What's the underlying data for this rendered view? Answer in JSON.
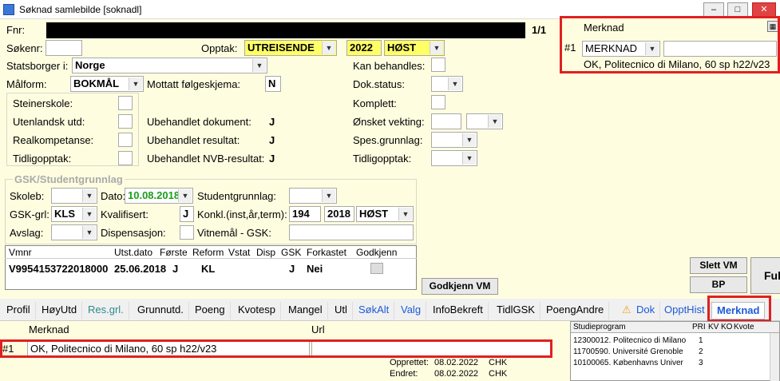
{
  "window": {
    "title": "Søknad samlebilde  [soknadl]",
    "minimize": "–",
    "restore": "□",
    "close": "✕"
  },
  "form": {
    "fnr_label": "Fnr:",
    "fnr_value": "",
    "page_indicator": "1/1",
    "sokenr_label": "Søkenr:",
    "sokenr_value": "",
    "opptak_label": "Opptak:",
    "opptak_value": "UTREISENDE",
    "year": "2022",
    "season": "HØST",
    "kan_behandles_label": "Kan behandles:",
    "statsborger_label": "Statsborger i:",
    "statsborger_value": "Norge",
    "malform_label": "Målform:",
    "malform_value": "BOKMÅL",
    "mottatt_label": "Mottatt følgeskjema:",
    "mottatt_value": "N",
    "dok_status_label": "Dok.status:",
    "steinerskole_label": "Steinerskole:",
    "utenlandsk_label": "Utenlandsk utd:",
    "realkompetanse_label": "Realkompetanse:",
    "tidligopptak_label": "Tidligopptak:",
    "komplett_label": "Komplett:",
    "ubehandlet_dok_label": "Ubehandlet dokument:",
    "ubehandlet_dok_value": "J",
    "onsket_label": "Ønsket vekting:",
    "ubehandlet_res_label": "Ubehandlet resultat:",
    "ubehandlet_res_value": "J",
    "spes_label": "Spes.grunnlag:",
    "ubehandlet_nvb_label": "Ubehandlet NVB-resultat:",
    "ubehandlet_nvb_value": "J",
    "tidligopptak2_label": "Tidligopptak:"
  },
  "gsk": {
    "section_title": "GSK/Studentgrunnlag",
    "skoleb_label": "Skoleb:",
    "dato_label": "Dato:",
    "dato_value": "10.08.2018",
    "studentgrunnlag_label": "Studentgrunnlag:",
    "gskgrl_label": "GSK-grl:",
    "gskgrl_value": "KLS",
    "kvalifisert_label": "Kvalifisert:",
    "kvalifisert_value": "J",
    "konkl_label": "Konkl.(inst,år,term):",
    "konkl_inst": "194",
    "konkl_year": "2018",
    "konkl_term": "HØST",
    "avslag_label": "Avslag:",
    "dispensasjon_label": "Dispensasjon:",
    "vitnemal_label": "Vitnemål - GSK:"
  },
  "vm_table": {
    "headers": [
      "Vmnr",
      "Utst.dato",
      "Første",
      "Reform",
      "Vstat",
      "Disp",
      "GSK",
      "Forkastet",
      "Godkjenn"
    ],
    "row": [
      "V9954153722018000",
      "25.06.2018",
      "J",
      "KL",
      "",
      "",
      "J",
      "Nei",
      ""
    ]
  },
  "buttons": {
    "godkjenn_vm": "Godkjenn VM",
    "slett_vm": "Slett VM",
    "bp": "BP",
    "ful": "Ful"
  },
  "merknad_panel": {
    "title": "Merknad",
    "row_no": "#1",
    "type_value": "MERKNAD",
    "text_value": "",
    "summary": "OK, Politecnico di Milano, 60 sp h22/v23"
  },
  "tabs": [
    "Profil",
    "HøyUtd",
    "Res.grl.",
    "Grunnutd.",
    "Poeng",
    "Kvotesp",
    "Mangel",
    "Utl",
    "SøkAlt",
    "Valg",
    "InfoBekreft",
    "TidlGSK",
    "PoengAndre",
    "Dok",
    "OpptHist",
    "Merknad"
  ],
  "bottom": {
    "merknad_header": "Merknad",
    "url_header": "Url",
    "row_no": "#1",
    "merknad_value": "OK, Politecnico di Milano, 60 sp h22/v23",
    "url_value": "",
    "opprettet_label": "Opprettet:",
    "opprettet_date": "08.02.2022",
    "opprettet_user": "CHK",
    "endret_label": "Endret:",
    "endret_date": "08.02.2022",
    "endret_user": "CHK"
  },
  "studieprogram": {
    "headers": [
      "Studieprogram",
      "PRI",
      "KV",
      "KO",
      "Kvote"
    ],
    "rows": [
      [
        "12300012. Politecnico di Milano",
        "1"
      ],
      [
        "11700590. Université Grenoble",
        "2"
      ],
      [
        "10100065. Københavns Univer",
        "3"
      ]
    ]
  },
  "colors": {
    "form_bg": "#fffde0",
    "highlight": "#ffff66",
    "red_outline": "#e02020",
    "green_date": "#1a9e1a",
    "tab_blue": "#1c5bd8"
  }
}
